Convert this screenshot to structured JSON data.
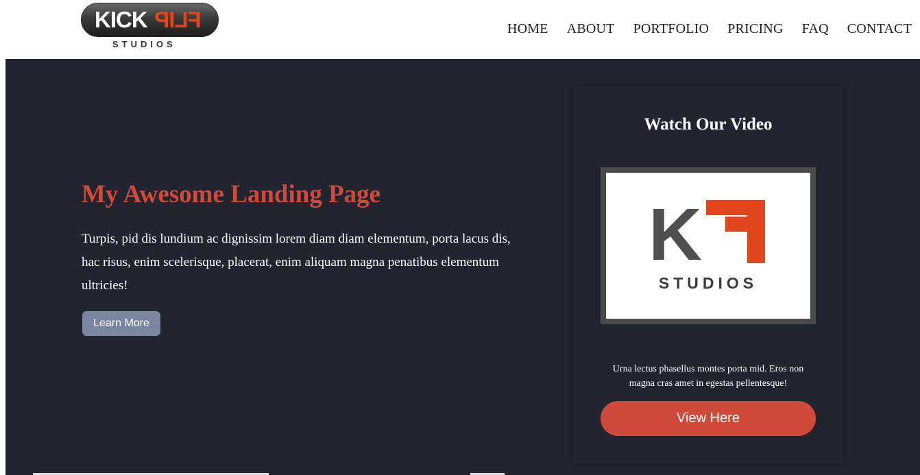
{
  "brand": {
    "logo_main": "KICK",
    "logo_accent": "FLIP",
    "logo_sub": "STUDIOS"
  },
  "nav": {
    "items": [
      {
        "label": "HOME"
      },
      {
        "label": "ABOUT"
      },
      {
        "label": "PORTFOLIO"
      },
      {
        "label": "PRICING"
      },
      {
        "label": "FAQ"
      },
      {
        "label": "CONTACT"
      }
    ]
  },
  "hero": {
    "title": "My Awesome Landing Page",
    "text": "Turpis, pid dis lundium ac dignissim lorem diam diam elementum, porta lacus dis, hac risus, enim scelerisque, placerat, enim aliquam magna penatibus elementum ultricies!",
    "button_label": "Learn More"
  },
  "video_card": {
    "title": "Watch Our Video",
    "thumbnail_logo": {
      "letter_k": "K",
      "sub": "STUDIOS"
    },
    "text": "Urna lectus phasellus montes porta mid. Eros non magna cras amet in egestas pellentesque!",
    "button_label": "View Here"
  },
  "colors": {
    "hero_bg": "#222530",
    "accent_red": "#cf4a3b",
    "button_slate": "#7b85a0",
    "logo_orange": "#e0461c"
  }
}
